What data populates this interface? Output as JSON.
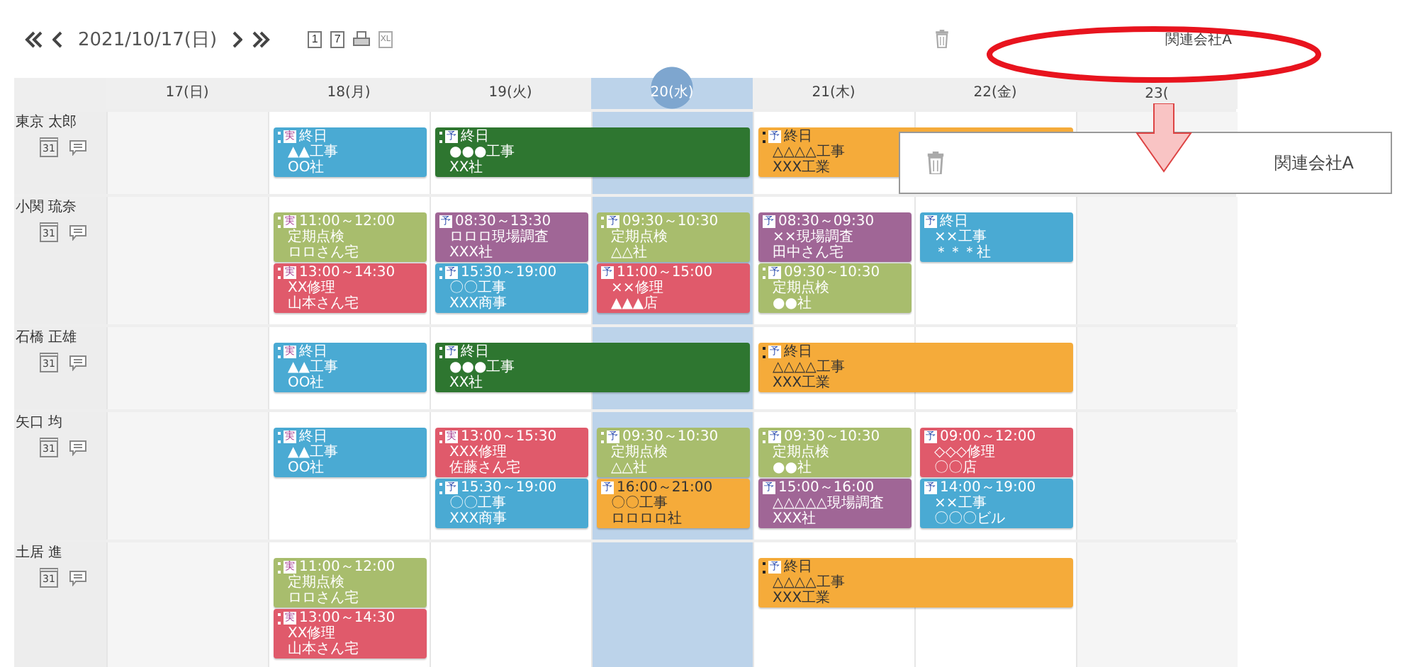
{
  "toolbar": {
    "date": "2021/10/17(日)",
    "view_buttons": [
      "1",
      "7"
    ],
    "excel_label": "XL",
    "company": "関連会社A"
  },
  "days": [
    {
      "label": "17(日)",
      "weekend": true,
      "selected": false
    },
    {
      "label": "18(月)",
      "weekend": false,
      "selected": false
    },
    {
      "label": "19(火)",
      "weekend": false,
      "selected": false
    },
    {
      "label": "20(水)",
      "weekend": false,
      "selected": true
    },
    {
      "label": "21(木)",
      "weekend": false,
      "selected": false
    },
    {
      "label": "22(金)",
      "weekend": false,
      "selected": false
    },
    {
      "label": "23(",
      "weekend": true,
      "selected": false
    }
  ],
  "rows": [
    {
      "name": "東京 太郎",
      "calendar_label": "31",
      "cells": [
        {},
        {
          "events": [
            {
              "multi_day": false,
              "kind": "actual",
              "status": "実",
              "draggable": true,
              "time": "終日",
              "title": "▲▲工事",
              "client": "OO社",
              "color": "#4aaad3"
            }
          ]
        },
        {
          "events": [
            {
              "multi_day": true,
              "kind": "plan",
              "status": "予",
              "draggable": true,
              "time": "終日",
              "title": "●●●工事",
              "client": "XX社",
              "color": "#2e7630"
            }
          ]
        },
        {},
        {
          "events": [
            {
              "multi_day": true,
              "kind": "plan",
              "status": "予",
              "draggable": true,
              "time": "終日",
              "title": "△△△△工事",
              "client": "XXX工業",
              "color": "#f5ab3a"
            }
          ]
        },
        {},
        {}
      ]
    },
    {
      "name": "小関 琉奈",
      "calendar_label": "31",
      "cells": [
        {},
        {
          "events": [
            {
              "multi_day": false,
              "kind": "actual",
              "status": "実",
              "draggable": true,
              "time": "11:00～12:00",
              "title": "定期点検",
              "client": "ロロさん宅",
              "color": "#a8bd6d"
            },
            {
              "multi_day": false,
              "kind": "actual",
              "status": "実",
              "draggable": true,
              "time": "13:00～14:30",
              "title": "XX修理",
              "client": "山本さん宅",
              "color": "#e05a6b"
            }
          ]
        },
        {
          "events": [
            {
              "multi_day": false,
              "kind": "plan",
              "status": "予",
              "draggable": false,
              "time": "08:30～13:30",
              "title": "ロロロ現場調査",
              "client": "XXX社",
              "color": "#a06696"
            },
            {
              "multi_day": false,
              "kind": "plan",
              "status": "予",
              "draggable": true,
              "time": "15:30～19:00",
              "title": "〇〇工事",
              "client": "XXX商事",
              "color": "#4aaad3"
            }
          ]
        },
        {
          "events": [
            {
              "multi_day": false,
              "kind": "plan",
              "status": "予",
              "draggable": true,
              "time": "09:30～10:30",
              "title": "定期点検",
              "client": "△△社",
              "color": "#a8bd6d"
            },
            {
              "multi_day": false,
              "kind": "plan",
              "status": "予",
              "draggable": false,
              "time": "11:00～15:00",
              "title": "××修理",
              "client": "▲▲▲店",
              "color": "#e05a6b"
            }
          ]
        },
        {
          "events": [
            {
              "multi_day": false,
              "kind": "plan",
              "status": "予",
              "draggable": false,
              "time": "08:30～09:30",
              "title": "××現場調査",
              "client": "田中さん宅",
              "color": "#a06696"
            },
            {
              "multi_day": false,
              "kind": "plan",
              "status": "予",
              "draggable": true,
              "time": "09:30～10:30",
              "title": "定期点検",
              "client": "●●社",
              "color": "#a8bd6d"
            }
          ]
        },
        {
          "events": [
            {
              "multi_day": false,
              "kind": "plan",
              "status": "予",
              "draggable": false,
              "time": "終日",
              "title": "××工事",
              "client": "＊＊＊社",
              "color": "#4aaad3"
            }
          ]
        },
        {}
      ]
    },
    {
      "name": "石橋 正雄",
      "calendar_label": "31",
      "cells": [
        {},
        {
          "events": [
            {
              "multi_day": false,
              "kind": "actual",
              "status": "実",
              "draggable": true,
              "time": "終日",
              "title": "▲▲工事",
              "client": "OO社",
              "color": "#4aaad3"
            }
          ]
        },
        {
          "events": [
            {
              "multi_day": true,
              "kind": "plan",
              "status": "予",
              "draggable": true,
              "time": "終日",
              "title": "●●●工事",
              "client": "XX社",
              "color": "#2e7630"
            }
          ]
        },
        {},
        {
          "events": [
            {
              "multi_day": true,
              "kind": "plan",
              "status": "予",
              "draggable": true,
              "time": "終日",
              "title": "△△△△工事",
              "client": "XXX工業",
              "color": "#f5ab3a"
            }
          ]
        },
        {},
        {}
      ]
    },
    {
      "name": "矢口 均",
      "calendar_label": "31",
      "cells": [
        {},
        {
          "events": [
            {
              "multi_day": false,
              "kind": "actual",
              "status": "実",
              "draggable": true,
              "time": "終日",
              "title": "▲▲工事",
              "client": "OO社",
              "color": "#4aaad3"
            }
          ]
        },
        {
          "events": [
            {
              "multi_day": false,
              "kind": "actual",
              "status": "実",
              "draggable": true,
              "time": "13:00～15:30",
              "title": "XXX修理",
              "client": "佐藤さん宅",
              "color": "#e05a6b"
            },
            {
              "multi_day": false,
              "kind": "plan",
              "status": "予",
              "draggable": true,
              "time": "15:30～19:00",
              "title": "〇〇工事",
              "client": "XXX商事",
              "color": "#4aaad3"
            }
          ]
        },
        {
          "events": [
            {
              "multi_day": false,
              "kind": "plan",
              "status": "予",
              "draggable": true,
              "time": "09:30～10:30",
              "title": "定期点検",
              "client": "△△社",
              "color": "#a8bd6d"
            },
            {
              "multi_day": false,
              "kind": "plan",
              "status": "予",
              "draggable": false,
              "time": "16:00～21:00",
              "title": "〇〇工事",
              "client": "ロロロロ社",
              "color": "#f5ab3a"
            }
          ]
        },
        {
          "events": [
            {
              "multi_day": false,
              "kind": "plan",
              "status": "予",
              "draggable": true,
              "time": "09:30～10:30",
              "title": "定期点検",
              "client": "●●社",
              "color": "#a8bd6d"
            },
            {
              "multi_day": false,
              "kind": "plan",
              "status": "予",
              "draggable": false,
              "time": "15:00～16:00",
              "title": "△△△△△現場調査",
              "client": "XXX社",
              "color": "#a06696"
            }
          ]
        },
        {
          "events": [
            {
              "multi_day": false,
              "kind": "plan",
              "status": "予",
              "draggable": false,
              "time": "09:00～12:00",
              "title": "◇◇◇修理",
              "client": "〇〇店",
              "color": "#e05a6b"
            },
            {
              "multi_day": false,
              "kind": "plan",
              "status": "予",
              "draggable": false,
              "time": "14:00～19:00",
              "title": "××工事",
              "client": "〇〇〇ビル",
              "color": "#4aaad3"
            }
          ]
        },
        {}
      ]
    },
    {
      "name": "土居 進",
      "calendar_label": "31",
      "cells": [
        {},
        {
          "events": [
            {
              "multi_day": false,
              "kind": "actual",
              "status": "実",
              "draggable": true,
              "time": "11:00～12:00",
              "title": "定期点検",
              "client": "ロロさん宅",
              "color": "#a8bd6d"
            },
            {
              "multi_day": false,
              "kind": "actual",
              "status": "実",
              "draggable": true,
              "time": "13:00～14:30",
              "title": "XX修理",
              "client": "山本さん宅",
              "color": "#e05a6b"
            }
          ]
        },
        {},
        {},
        {
          "events": [
            {
              "multi_day": true,
              "kind": "plan",
              "status": "予",
              "draggable": true,
              "time": "終日",
              "title": "△△△△工事",
              "client": "XXX工業",
              "color": "#f5ab3a"
            }
          ]
        },
        {},
        {}
      ]
    }
  ],
  "callout": {
    "label": "関連会社A"
  }
}
